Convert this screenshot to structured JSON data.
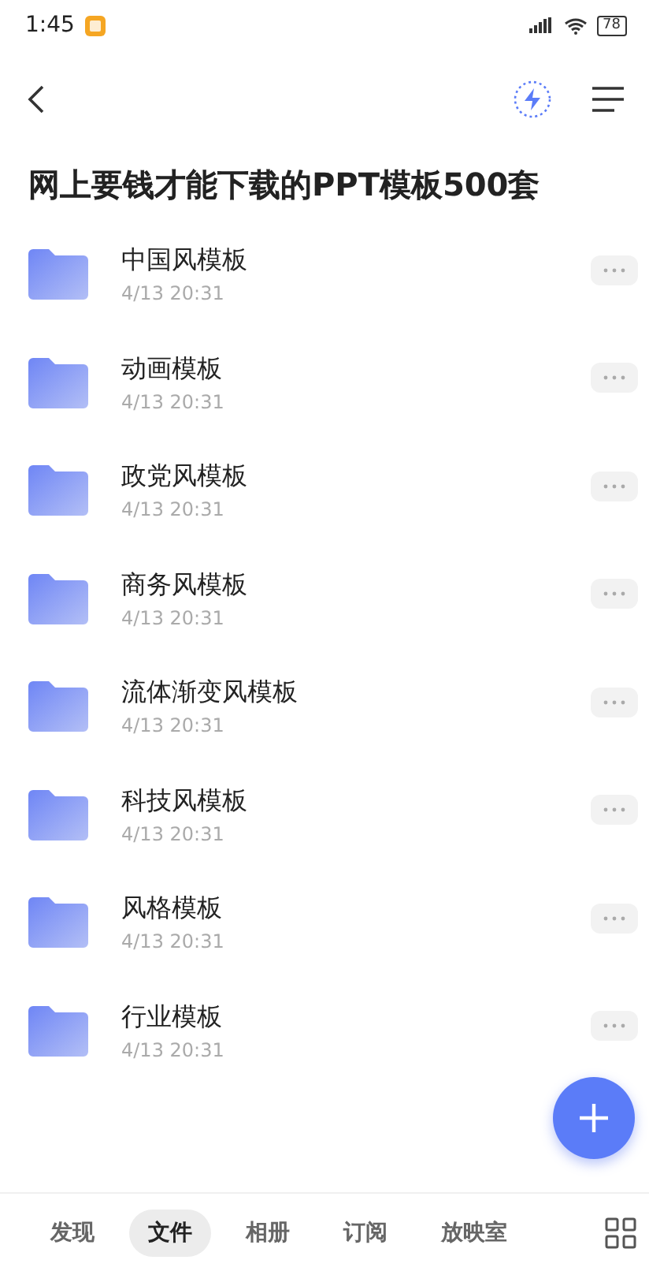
{
  "status_bar": {
    "time": "1:45",
    "battery": "78"
  },
  "title": "网上要钱才能下载的PPT模板500套",
  "folders": [
    {
      "name": "中国风模板",
      "date": "4/13 20:31"
    },
    {
      "name": "动画模板",
      "date": "4/13 20:31"
    },
    {
      "name": "政党风模板",
      "date": "4/13 20:31"
    },
    {
      "name": "商务风模板",
      "date": "4/13 20:31"
    },
    {
      "name": "流体渐变风模板",
      "date": "4/13 20:31"
    },
    {
      "name": "科技风模板",
      "date": "4/13 20:31"
    },
    {
      "name": "风格模板",
      "date": "4/13 20:31"
    },
    {
      "name": "行业模板",
      "date": "4/13 20:31"
    }
  ],
  "tabs": [
    {
      "label": "发现",
      "selected": false
    },
    {
      "label": "文件",
      "selected": true
    },
    {
      "label": "相册",
      "selected": false
    },
    {
      "label": "订阅",
      "selected": false
    },
    {
      "label": "放映室",
      "selected": false
    }
  ]
}
